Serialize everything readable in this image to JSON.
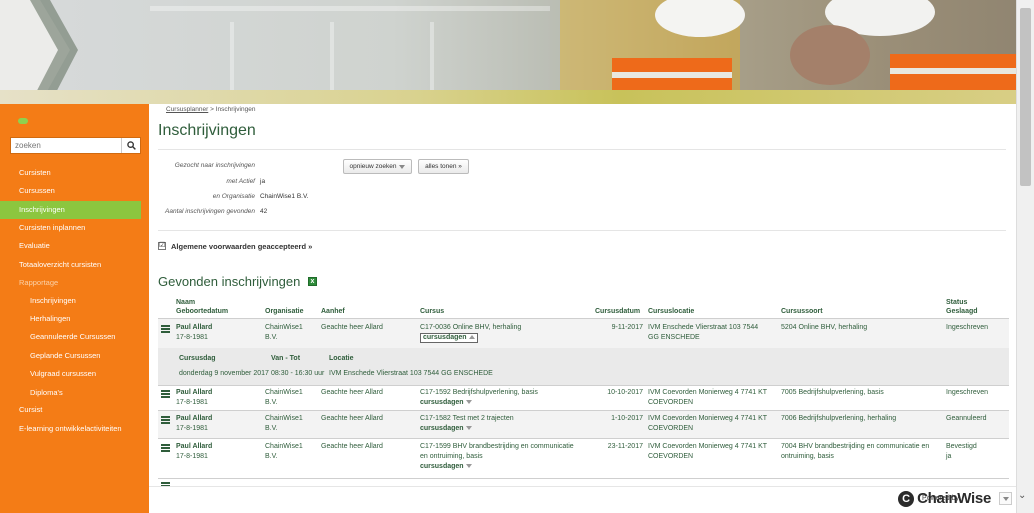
{
  "search": {
    "placeholder": "zoeken"
  },
  "nav": [
    {
      "label": "Cursisten",
      "level": 0,
      "state": ""
    },
    {
      "label": "Cursussen",
      "level": 0,
      "state": ""
    },
    {
      "label": "Inschrijvingen",
      "level": 0,
      "state": "active"
    },
    {
      "label": "Cursisten inplannen",
      "level": 0,
      "state": ""
    },
    {
      "label": "Evaluatie",
      "level": 0,
      "state": ""
    },
    {
      "label": "Totaaloverzicht cursisten",
      "level": 0,
      "state": ""
    },
    {
      "label": "Rapportage",
      "level": 0,
      "state": "muted"
    },
    {
      "label": "Inschrijvingen",
      "level": 1,
      "state": ""
    },
    {
      "label": "Herhalingen",
      "level": 1,
      "state": ""
    },
    {
      "label": "Geannuleerde Cursussen",
      "level": 1,
      "state": ""
    },
    {
      "label": "Geplande Cursussen",
      "level": 1,
      "state": ""
    },
    {
      "label": "Vulgraad cursussen",
      "level": 1,
      "state": ""
    },
    {
      "label": "Diploma's",
      "level": 1,
      "state": ""
    },
    {
      "label": "Cursist",
      "level": 0,
      "state": ""
    },
    {
      "label": "E-learning ontwikkelactiviteiten",
      "level": 0,
      "state": ""
    }
  ],
  "breadcrumb": {
    "link": "Cursusplanner",
    "sep": " > ",
    "current": "Inschrijvingen"
  },
  "page_title": "Inschrijvingen",
  "search_summary": {
    "rows": [
      {
        "label": "Gezocht naar inschrijvingen",
        "value": ""
      },
      {
        "label": "met Actief",
        "value": "ja"
      },
      {
        "label": "en Organisatie",
        "value": "ChainWise1 B.V."
      },
      {
        "label": "Aantal inschrijvingen gevonden",
        "value": "42"
      }
    ],
    "btn_new_search": "opnieuw zoeken",
    "btn_show_all": "alles tonen »"
  },
  "terms": {
    "checked": "☑",
    "label": "Algemene voorwaarden geaccepteerd »"
  },
  "results": {
    "title": "Gevonden inschrijvingen",
    "headers": {
      "naam": "Naam",
      "geboortedatum": "Geboortedatum",
      "organisatie": "Organisatie",
      "aanhef": "Aanhef",
      "cursus": "Cursus",
      "cursusdatum": "Cursusdatum",
      "cursuslocatie": "Cursuslocatie",
      "cursussoort": "Cursussoort",
      "status": "Status",
      "geslaagd": "Geslaagd"
    },
    "rows": [
      {
        "naam": "Paul Allard",
        "geb": "17-8-1981",
        "org1": "ChainWise1",
        "org2": "B.V.",
        "aanhef": "Geachte heer Allard",
        "cursus1": "C17-0036 Online BHV, herhaling",
        "cursus2": "",
        "sub": "cursusdagen",
        "datum": "9-11-2017",
        "loc1": "IVM Enschede Vlierstraat 103 7544",
        "loc2": "GG ENSCHEDE",
        "soort1": "5204 Online BHV, herhaling",
        "soort2": "",
        "status1": "Ingeschreven",
        "status2": ""
      },
      {
        "naam": "Paul Allard",
        "geb": "17-8-1981",
        "org1": "ChainWise1",
        "org2": "B.V.",
        "aanhef": "Geachte heer Allard",
        "cursus1": "C17-1592 Bedrijfshulpverlening, basis",
        "cursus2": "",
        "sub": "cursusdagen",
        "datum": "10-10-2017",
        "loc1": "IVM Coevorden Monierweg 4 7741 KT",
        "loc2": "COEVORDEN",
        "soort1": "7005 Bedrijfshulpverlening, basis",
        "soort2": "",
        "status1": "Ingeschreven",
        "status2": ""
      },
      {
        "naam": "Paul Allard",
        "geb": "17-8-1981",
        "org1": "ChainWise1",
        "org2": "B.V.",
        "aanhef": "Geachte heer Allard",
        "cursus1": "C17-1582 Test met 2 trajecten",
        "cursus2": "",
        "sub": "cursusdagen",
        "datum": "1-10-2017",
        "loc1": "IVM Coevorden Monierweg 4 7741 KT",
        "loc2": "COEVORDEN",
        "soort1": "7006 Bedrijfshulpverlening, herhaling",
        "soort2": "",
        "status1": "Geannuleerd",
        "status2": ""
      },
      {
        "naam": "Paul Allard",
        "geb": "17-8-1981",
        "org1": "ChainWise1",
        "org2": "B.V.",
        "aanhef": "Geachte heer Allard",
        "cursus1": "C17-1599 BHV brandbestrijding en communicatie",
        "cursus2": "en ontruiming, basis",
        "sub": "cursusdagen",
        "datum": "23-11-2017",
        "loc1": "IVM Coevorden Monierweg 4 7741 KT",
        "loc2": "COEVORDEN",
        "soort1": "7004 BHV brandbestrijding en communicatie en",
        "soort2": "ontruiming, basis",
        "status1": "Bevestigd",
        "status2": "ja"
      }
    ],
    "detail": {
      "headers": {
        "dag": "Cursusdag",
        "tijd": "Van - Tot",
        "locatie": "Locatie"
      },
      "dag": "donderdag 9 november 2017",
      "tijd": "08:30 - 16:30 uur",
      "locatie": "IVM Enschede Vlierstraat 103 7544 GG ENSCHEDE"
    }
  },
  "footer": {
    "powered": "Powered by",
    "brand": "ChainWise"
  }
}
